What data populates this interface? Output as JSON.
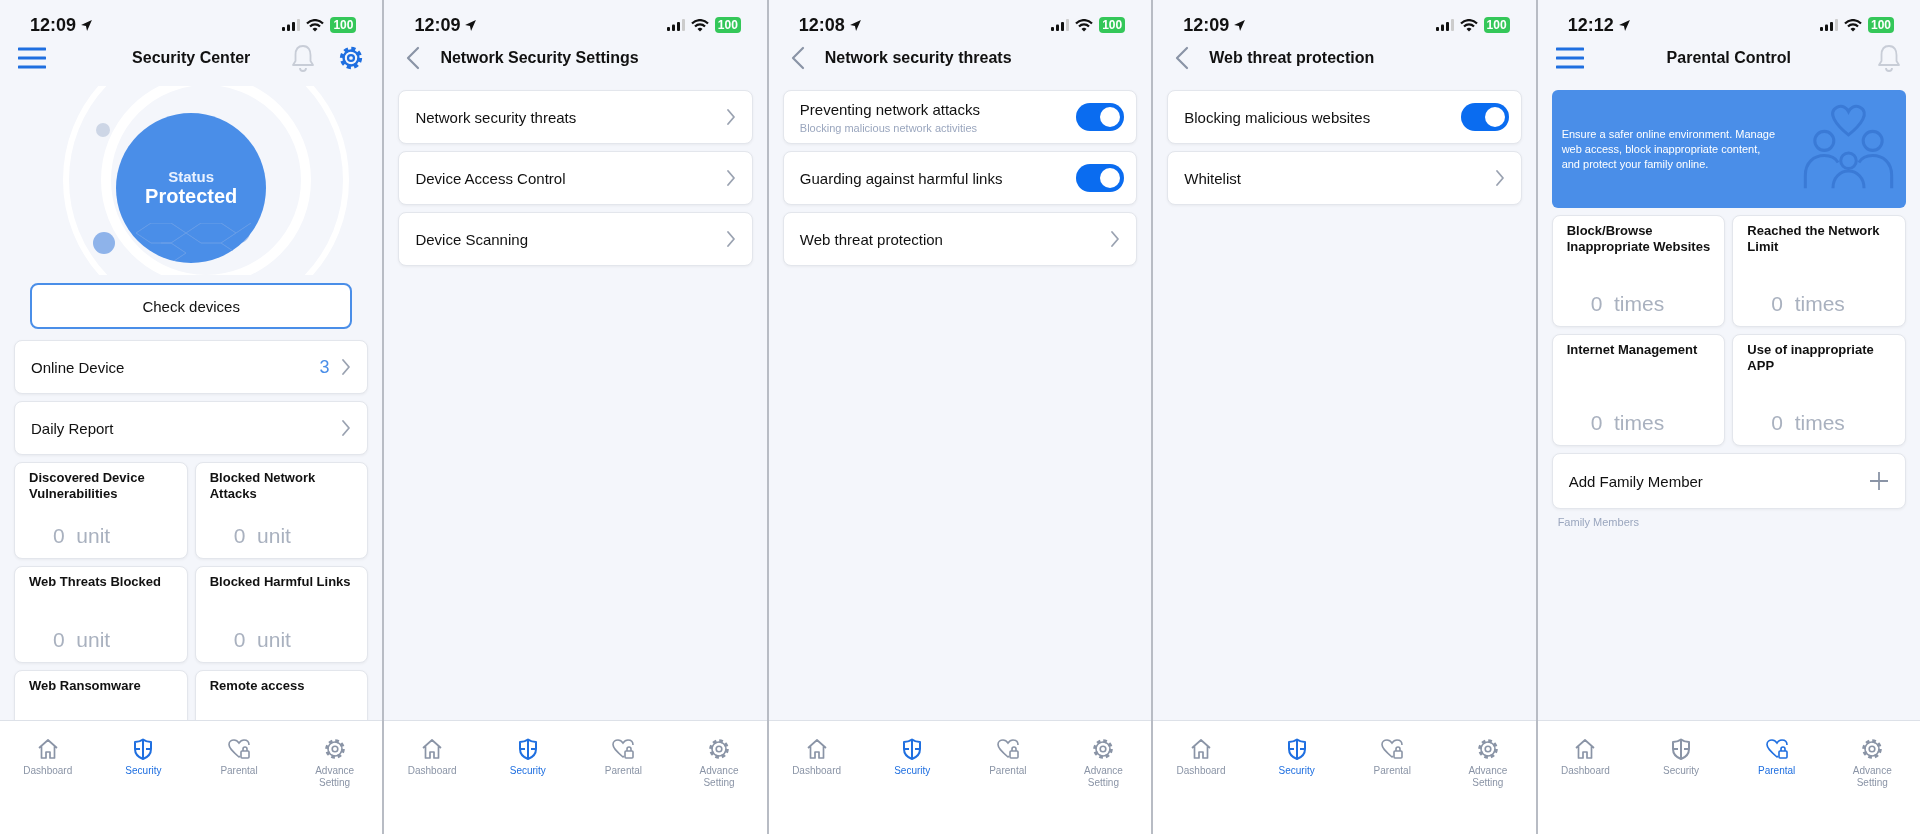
{
  "screens": [
    {
      "kind": "main_settings",
      "time": "12:09",
      "battery": "100",
      "header": {
        "title": "Security Center"
      },
      "blocks": [
        {
          "kind": "status_circle",
          "label": "Status",
          "value": "Protected"
        },
        {
          "kind": "outline_button",
          "label": "Check devices"
        },
        {
          "kind": "row",
          "label": "Online Device",
          "value": "3"
        },
        {
          "kind": "row",
          "label": "Daily Report"
        },
        {
          "kind": "tiles",
          "items": [
            {
              "title": "Discovered Device Vulnerabilities",
              "count": "0",
              "unit": "unit"
            },
            {
              "title": "Blocked Network Attacks",
              "count": "0",
              "unit": "unit"
            },
            {
              "title": "Web Threats Blocked",
              "count": "0",
              "unit": "unit"
            },
            {
              "title": "Blocked Harmful Links",
              "count": "0",
              "unit": "unit"
            },
            {
              "title": "Web Ransomware"
            },
            {
              "title": "Remote access"
            }
          ]
        }
      ],
      "tabs": [
        {
          "label": "Dashboard",
          "selected": false
        },
        {
          "label": "Security",
          "selected": true
        },
        {
          "label": "Parental",
          "selected": false
        },
        {
          "label": "Advance Setting",
          "selected": false
        }
      ]
    },
    {
      "kind": "sub",
      "time": "12:09",
      "battery": "100",
      "header": {
        "title": "Network Security Settings"
      },
      "blocks": [
        {
          "kind": "row",
          "label": "Network security threats"
        },
        {
          "kind": "row",
          "label": "Device Access Control"
        },
        {
          "kind": "row",
          "label": "Device Scanning"
        }
      ],
      "tabs": [
        {
          "label": "Dashboard",
          "selected": false
        },
        {
          "label": "Security",
          "selected": true
        },
        {
          "label": "Parental",
          "selected": false
        },
        {
          "label": "Advance Setting",
          "selected": false
        }
      ]
    },
    {
      "kind": "sub",
      "time": "12:08",
      "battery": "100",
      "header": {
        "title": "Network security threats"
      },
      "blocks": [
        {
          "kind": "toggle_row",
          "label": "Preventing network attacks",
          "sublabel": "Blocking malicious network activities",
          "on": true
        },
        {
          "kind": "toggle_row",
          "label": "Guarding against harmful links",
          "on": true
        },
        {
          "kind": "row",
          "label": "Web threat protection"
        }
      ],
      "tabs": [
        {
          "label": "Dashboard",
          "selected": false
        },
        {
          "label": "Security",
          "selected": true
        },
        {
          "label": "Parental",
          "selected": false
        },
        {
          "label": "Advance Setting",
          "selected": false
        }
      ]
    },
    {
      "kind": "sub",
      "time": "12:09",
      "battery": "100",
      "header": {
        "title": "Web threat protection"
      },
      "blocks": [
        {
          "kind": "toggle_row",
          "label": "Blocking malicious websites",
          "on": true
        },
        {
          "kind": "row",
          "label": "Whitelist"
        }
      ],
      "tabs": [
        {
          "label": "Dashboard",
          "selected": false
        },
        {
          "label": "Security",
          "selected": true
        },
        {
          "label": "Parental",
          "selected": false
        },
        {
          "label": "Advance Setting",
          "selected": false
        }
      ]
    },
    {
      "kind": "main",
      "time": "12:12",
      "battery": "100",
      "header": {
        "title": "Parental Control"
      },
      "blocks": [
        {
          "kind": "banner",
          "text": "Ensure a safer online environment. Manage web access, block inappropriate content, and protect your family online."
        },
        {
          "kind": "tiles",
          "items": [
            {
              "title": "Block/Browse Inappropriate Websites",
              "count": "0",
              "unit": "times"
            },
            {
              "title": "Reached the Network Limit",
              "count": "0",
              "unit": "times"
            },
            {
              "title": "Internet Management",
              "count": "0",
              "unit": "times"
            },
            {
              "title": "Use of inappropriate APP",
              "count": "0",
              "unit": "times"
            }
          ]
        },
        {
          "kind": "add_row",
          "label": "Add Family Member"
        },
        {
          "kind": "caption",
          "text": "Family Members"
        }
      ],
      "tabs": [
        {
          "label": "Dashboard",
          "selected": false
        },
        {
          "label": "Security",
          "selected": false
        },
        {
          "label": "Parental",
          "selected": true
        },
        {
          "label": "Advance Setting",
          "selected": false
        }
      ]
    }
  ]
}
